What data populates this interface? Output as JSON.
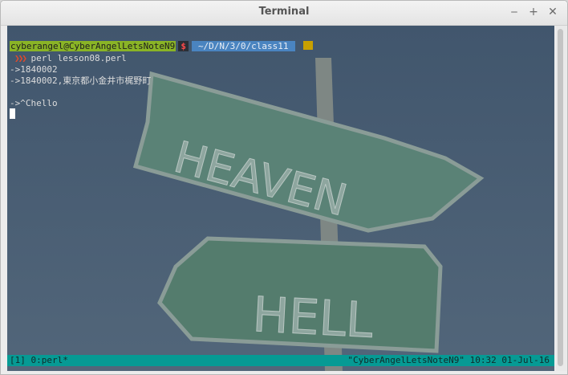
{
  "window": {
    "title": "Terminal",
    "buttons": {
      "minimize": "‒",
      "maximize": "+",
      "close": "✕"
    }
  },
  "terminal": {
    "prompt": {
      "user_host": "cyberangel@CyberAngelLetsNoteN9",
      "dollar": "$",
      "path": "~/D/N/3/0/class11",
      "arrows": "❯❯❯",
      "command": " perl lesson08.perl"
    },
    "output": [
      "->1840002",
      "->1840002,東京都小金井市梶野町",
      "",
      "->^Chello"
    ],
    "status": {
      "left": "[1] 0:perl*",
      "right": "\"CyberAngelLetsNoteN9\" 10:32 01-Jul-16"
    },
    "wallpaper_text": {
      "heaven": "HEAVEN",
      "hell": "HELL"
    }
  },
  "colors": {
    "terminal_bg": "#3c5168",
    "prompt_user_bg": "#8ab426",
    "prompt_path_bg": "#4a84c0",
    "status_bg": "#069a94"
  }
}
